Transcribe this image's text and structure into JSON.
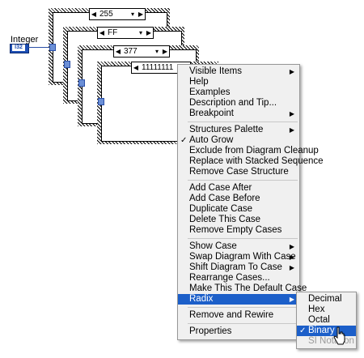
{
  "control": {
    "label": "Integer",
    "type_badge": "I32"
  },
  "case_values": [
    "255",
    "FF",
    "377",
    "11111111"
  ],
  "context_menu": {
    "groups": [
      [
        {
          "label": "Visible Items",
          "submenu": true
        },
        {
          "label": "Help"
        },
        {
          "label": "Examples"
        },
        {
          "label": "Description and Tip..."
        },
        {
          "label": "Breakpoint",
          "submenu": true
        }
      ],
      [
        {
          "label": "Structures Palette",
          "submenu": true
        },
        {
          "label": "Auto Grow",
          "checked": true
        },
        {
          "label": "Exclude from Diagram Cleanup"
        },
        {
          "label": "Replace with Stacked Sequence"
        },
        {
          "label": "Remove Case Structure"
        }
      ],
      [
        {
          "label": "Add Case After"
        },
        {
          "label": "Add Case Before"
        },
        {
          "label": "Duplicate Case"
        },
        {
          "label": "Delete This Case"
        },
        {
          "label": "Remove Empty Cases"
        }
      ],
      [
        {
          "label": "Show Case",
          "submenu": true
        },
        {
          "label": "Swap Diagram With Case",
          "submenu": true
        },
        {
          "label": "Shift Diagram To Case",
          "submenu": true
        },
        {
          "label": "Rearrange Cases..."
        },
        {
          "label": "Make This The Default Case"
        },
        {
          "label": "Radix",
          "submenu": true,
          "highlighted": true
        }
      ],
      [
        {
          "label": "Remove and Rewire"
        }
      ],
      [
        {
          "label": "Properties"
        }
      ]
    ]
  },
  "radix_submenu": {
    "items": [
      {
        "label": "Decimal"
      },
      {
        "label": "Hex"
      },
      {
        "label": "Octal"
      },
      {
        "label": "Binary",
        "checked": true,
        "highlighted": true
      },
      {
        "label": "SI Notation",
        "disabled": true
      }
    ]
  },
  "colors": {
    "highlight": "#1c5fc9",
    "wire": "#2a4fa8"
  }
}
